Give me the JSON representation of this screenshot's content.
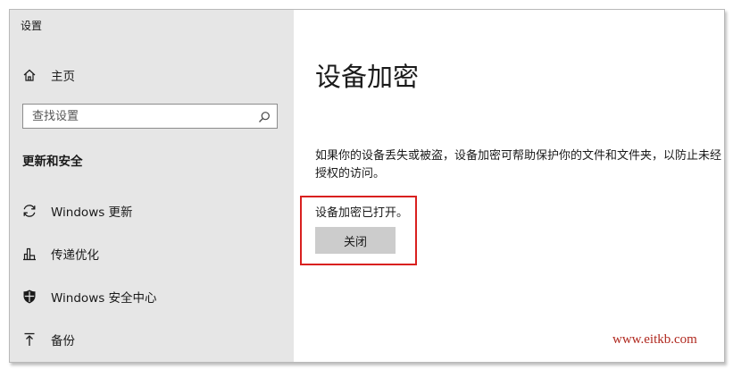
{
  "window": {
    "title": "设置"
  },
  "sidebar": {
    "home_label": "主页",
    "search_placeholder": "查找设置",
    "section_heading": "更新和安全",
    "items": [
      {
        "label": "Windows 更新",
        "icon": "refresh-icon"
      },
      {
        "label": "传递优化",
        "icon": "delivery-optimization-icon"
      },
      {
        "label": "Windows 安全中心",
        "icon": "shield-icon"
      },
      {
        "label": "备份",
        "icon": "backup-arrow-icon"
      }
    ]
  },
  "main": {
    "title": "设备加密",
    "description": "如果你的设备丢失或被盗，设备加密可帮助保护你的文件和文件夹，以防止未经授权的访问。",
    "status": "设备加密已打开。",
    "close_button_label": "关闭"
  },
  "annotation": {
    "highlight_color": "#d9201f"
  },
  "watermark": {
    "text": "www.eitkb.com"
  },
  "colors": {
    "sidebar_bg": "#e6e6e6",
    "content_bg": "#ffffff",
    "button_bg": "#cccccc",
    "watermark": "#b0291f"
  }
}
